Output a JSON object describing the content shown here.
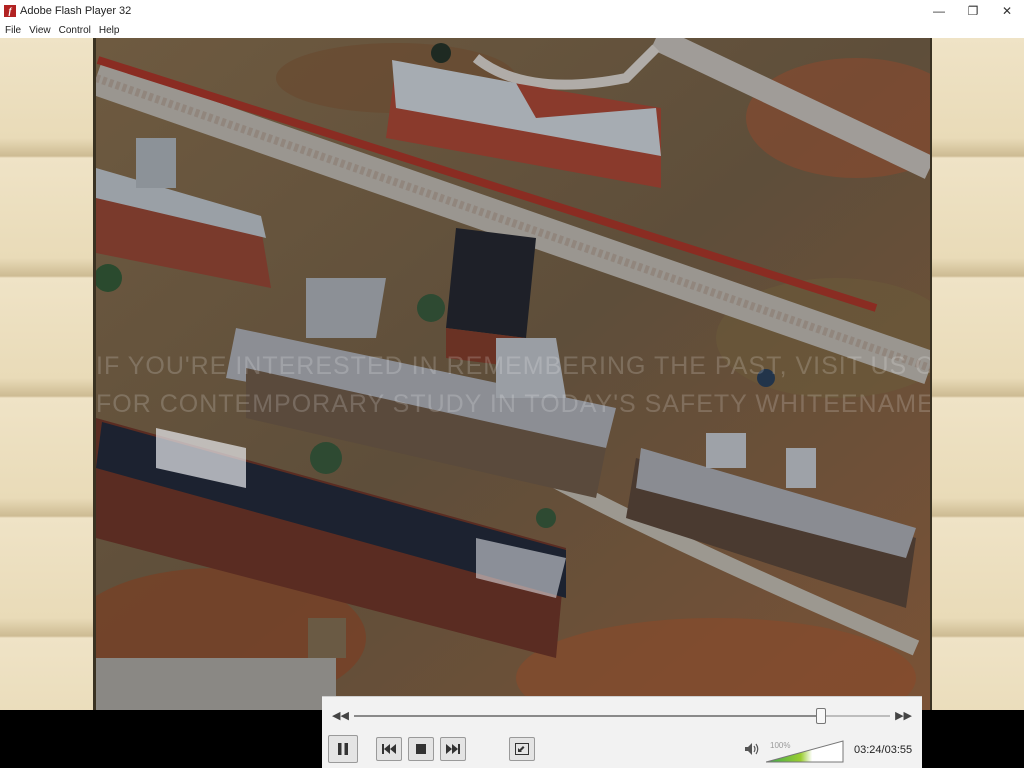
{
  "window": {
    "title": "Adobe Flash Player 32",
    "app_icon_glyph": "f",
    "controls": {
      "minimize": "—",
      "restore": "❐",
      "close": "✕"
    }
  },
  "menu": {
    "items": [
      "File",
      "View",
      "Control",
      "Help"
    ]
  },
  "stage": {
    "watermark_line1": "IF YOU'RE INTERESTED IN REMEMBERING THE PAST, VISIT US ONLINE AND JOIN OUR",
    "watermark_line2": "FOR CONTEMPORARY STUDY IN TODAY'S SAFETY  WHITEENAMEL.COM"
  },
  "player": {
    "seek_progress": 0.872,
    "volume_label": "100%",
    "volume_level": 1.0,
    "time_current": "03:24",
    "time_separator": "/",
    "time_total": "03:55",
    "colors": {
      "accent": "#4caf50",
      "panel": "#f2f2f2"
    }
  }
}
